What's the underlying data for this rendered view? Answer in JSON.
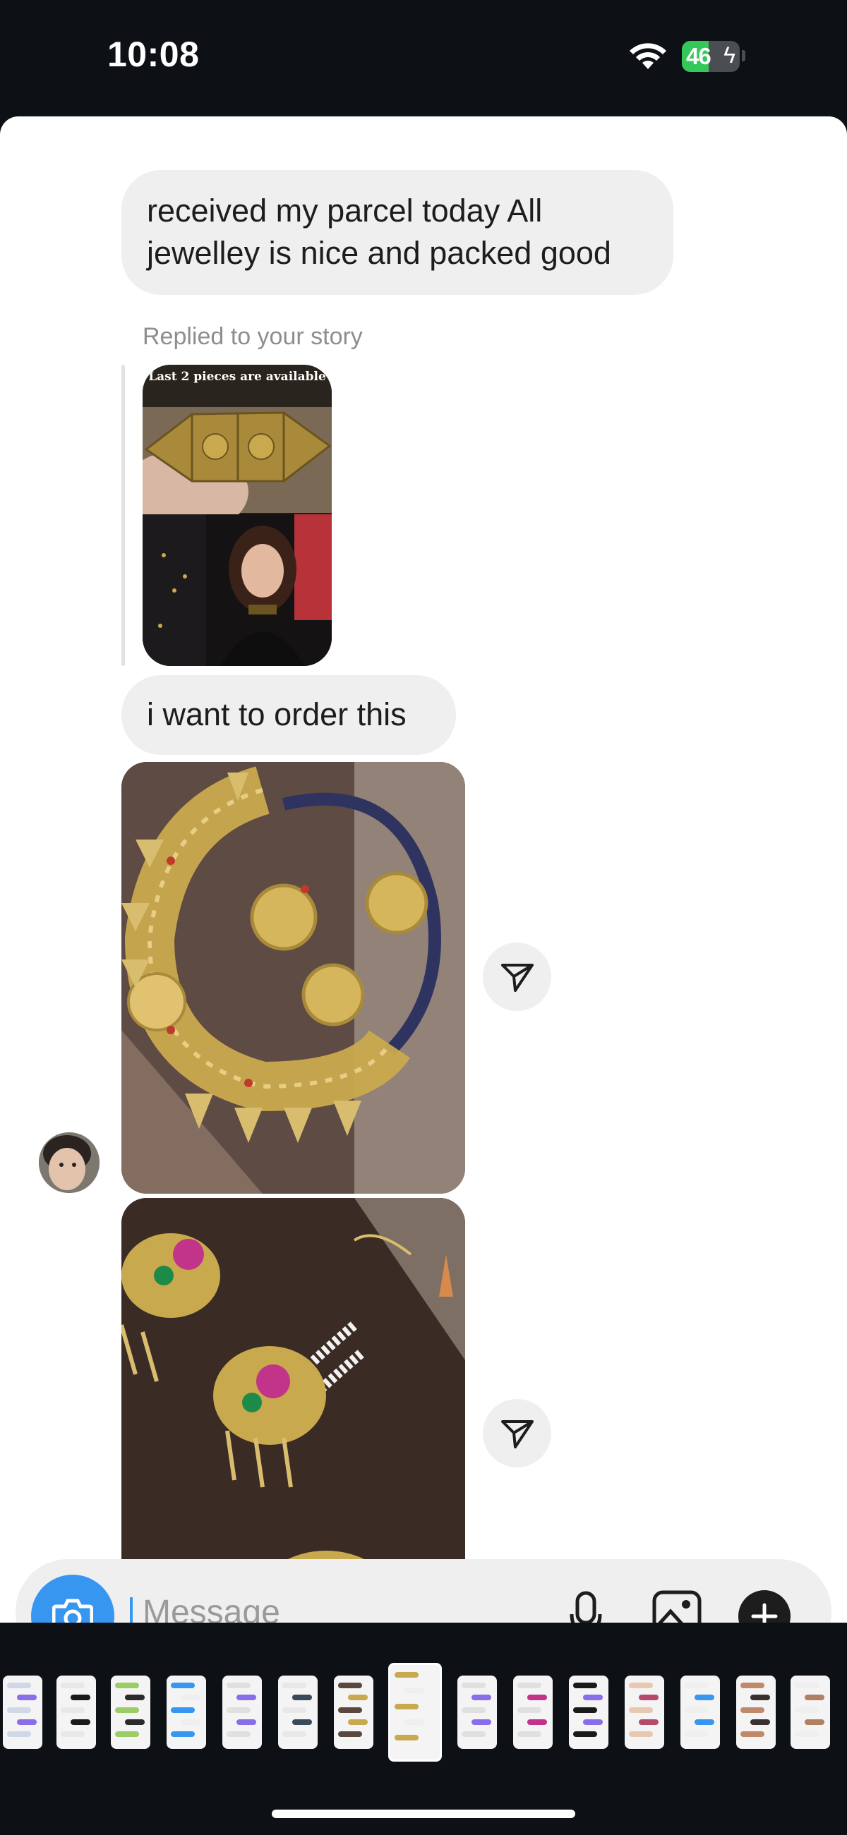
{
  "status_bar": {
    "time": "10:08",
    "battery_level": "46",
    "battery_fraction": 0.46,
    "icons": [
      "wifi-icon",
      "battery-icon",
      "charging-bolt-icon"
    ]
  },
  "conversation": {
    "messages": [
      {
        "type": "text",
        "text": "received my parcel today  All jewelley is nice and packed good"
      },
      {
        "type": "story-reply",
        "label": "Replied to your story",
        "story_caption": "Last 2 pieces are available"
      },
      {
        "type": "text",
        "text": "i want to order this"
      },
      {
        "type": "image",
        "description_icon": "necklace-photo"
      },
      {
        "type": "image",
        "description_icon": "earrings-photo"
      }
    ],
    "share_icon": "paper-plane-icon"
  },
  "composer": {
    "placeholder": "Message",
    "icons": [
      "camera-icon",
      "microphone-icon",
      "gallery-icon",
      "plus-icon"
    ]
  },
  "app_switcher": {
    "thumbnail_count": 15,
    "active_index": 7
  },
  "colors": {
    "accent_blue": "#3797f0",
    "bubble_gray": "#efefef",
    "background_dark": "#0d1116",
    "battery_green": "#34c759"
  }
}
